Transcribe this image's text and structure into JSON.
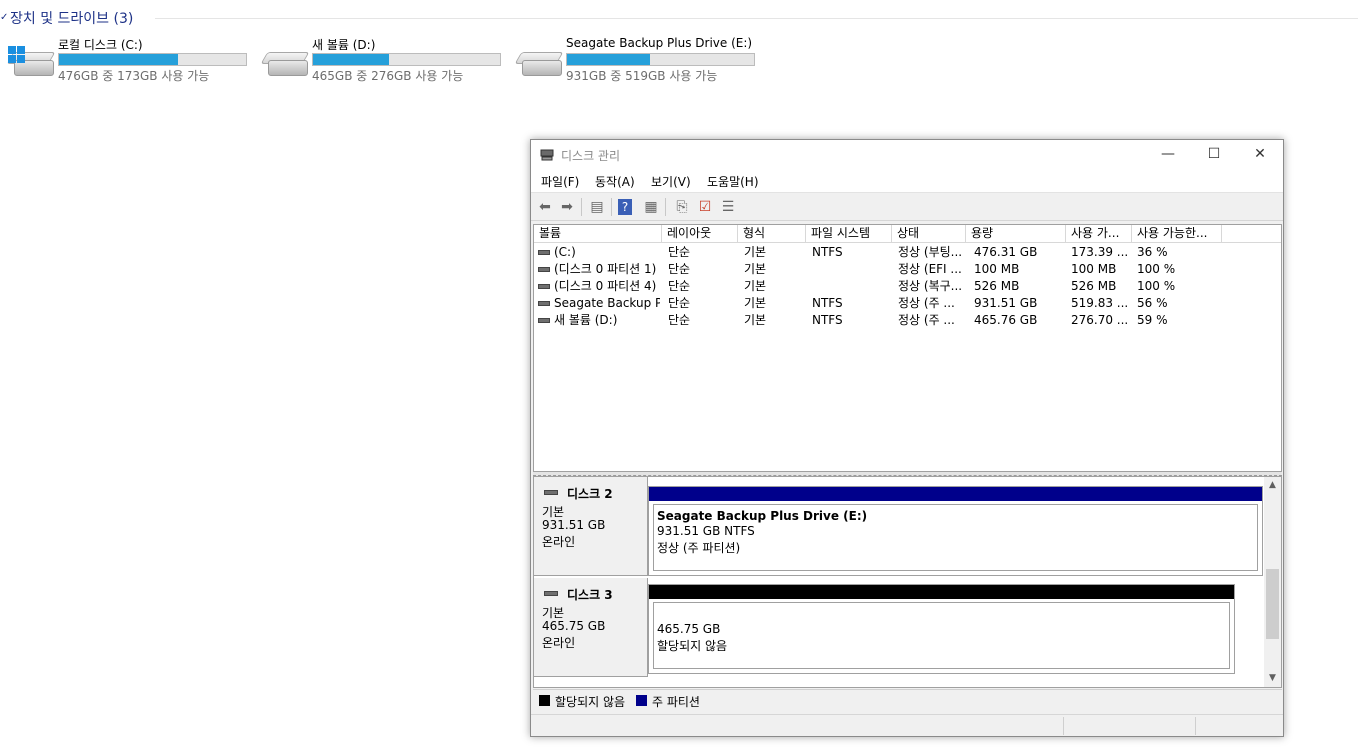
{
  "explorer": {
    "section_title": "장치 및 드라이브 (3)",
    "drives": [
      {
        "name": "로컬 디스크 (C:)",
        "subtitle": "476GB 중 173GB 사용 가능",
        "used_fraction": 0.636,
        "icon": "windows-drive-icon"
      },
      {
        "name": "새 볼륨 (D:)",
        "subtitle": "465GB 중 276GB 사용 가능",
        "used_fraction": 0.406,
        "icon": "hard-drive-icon"
      },
      {
        "name": "Seagate Backup Plus Drive (E:)",
        "subtitle": "931GB 중 519GB 사용 가능",
        "used_fraction": 0.442,
        "icon": "hard-drive-icon"
      }
    ],
    "bar_color": "#26a0da"
  },
  "window": {
    "title": "디스크 관리",
    "controls": {
      "minimize": "—",
      "maximize": "☐",
      "close": "✕"
    },
    "menu": [
      "파일(F)",
      "동작(A)",
      "보기(V)",
      "도움말(H)"
    ],
    "columns": [
      "볼륨",
      "레이아웃",
      "형식",
      "파일 시스템",
      "상태",
      "용량",
      "사용 가...",
      "사용 가능한..."
    ],
    "volumes": [
      {
        "volume": " (C:)",
        "layout": "단순",
        "type": "기본",
        "fs": "NTFS",
        "status": "정상 (부팅...",
        "capacity": "476.31 GB",
        "free": "173.39 ...",
        "free_pct": "36 %"
      },
      {
        "volume": "(디스크 0 파티션 1)",
        "layout": "단순",
        "type": "기본",
        "fs": "",
        "status": "정상 (EFI ...",
        "capacity": "100 MB",
        "free": "100 MB",
        "free_pct": "100 %"
      },
      {
        "volume": "(디스크 0 파티션 4)",
        "layout": "단순",
        "type": "기본",
        "fs": "",
        "status": "정상 (복구...",
        "capacity": "526 MB",
        "free": "526 MB",
        "free_pct": "100 %"
      },
      {
        "volume": "Seagate Backup P...",
        "layout": "단순",
        "type": "기본",
        "fs": "NTFS",
        "status": "정상 (주 ...",
        "capacity": "931.51 GB",
        "free": "519.83 ...",
        "free_pct": "56 %"
      },
      {
        "volume": "새 볼륨 (D:)",
        "layout": "단순",
        "type": "기본",
        "fs": "NTFS",
        "status": "정상 (주 ...",
        "capacity": "465.76 GB",
        "free": "276.70 ...",
        "free_pct": "59 %"
      }
    ],
    "disks": [
      {
        "name": "디스크 2",
        "kind": "기본",
        "size": "931.51 GB",
        "state": "온라인",
        "partition": {
          "title": "Seagate Backup Plus Drive  (E:)",
          "line1": "931.51 GB NTFS",
          "line2": "정상 (주 파티션)",
          "band_color": "#00008b"
        }
      },
      {
        "name": "디스크 3",
        "kind": "기본",
        "size": "465.75 GB",
        "state": "온라인",
        "partition": {
          "title": "",
          "line1": "465.75 GB",
          "line2": "할당되지 않음",
          "band_color": "#000000"
        }
      }
    ],
    "legend": [
      {
        "label": "할당되지 않음",
        "color": "#000000"
      },
      {
        "label": "주 파티션",
        "color": "#00008b"
      }
    ]
  }
}
